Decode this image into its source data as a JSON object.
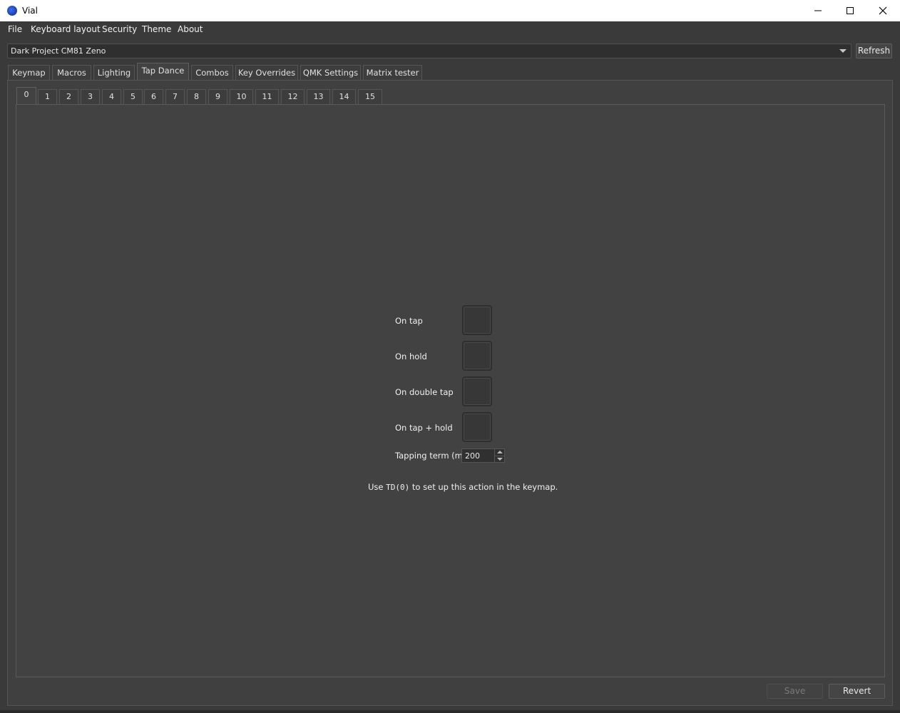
{
  "window": {
    "title": "Vial"
  },
  "menu": [
    "File",
    "Keyboard layout",
    "Security",
    "Theme",
    "About"
  ],
  "device": {
    "selected": "Dark Project CM81 Zeno",
    "refresh_label": "Refresh"
  },
  "main_tabs": [
    "Keymap",
    "Macros",
    "Lighting",
    "Tap Dance",
    "Combos",
    "Key Overrides",
    "QMK Settings",
    "Matrix tester"
  ],
  "active_main_tab": "Tap Dance",
  "tapdance_tabs": [
    "0",
    "1",
    "2",
    "3",
    "4",
    "5",
    "6",
    "7",
    "8",
    "9",
    "10",
    "11",
    "12",
    "13",
    "14",
    "15"
  ],
  "active_tapdance_tab": "0",
  "editor": {
    "on_tap": "On tap",
    "on_hold": "On hold",
    "on_double_tap": "On double tap",
    "on_tap_hold": "On tap + hold",
    "tapping_term_label": "Tapping term (ms)",
    "tapping_term_value": "200",
    "hint_prefix": "Use",
    "hint_code": "TD(0)",
    "hint_suffix": "to set up this action in the keymap."
  },
  "footer": {
    "save_label": "Save",
    "revert_label": "Revert"
  },
  "icons": [
    "vial-logo-icon",
    "minimize-icon",
    "maximize-icon",
    "close-icon",
    "dropdown-arrow-icon",
    "spin-up-icon",
    "spin-down-icon"
  ]
}
